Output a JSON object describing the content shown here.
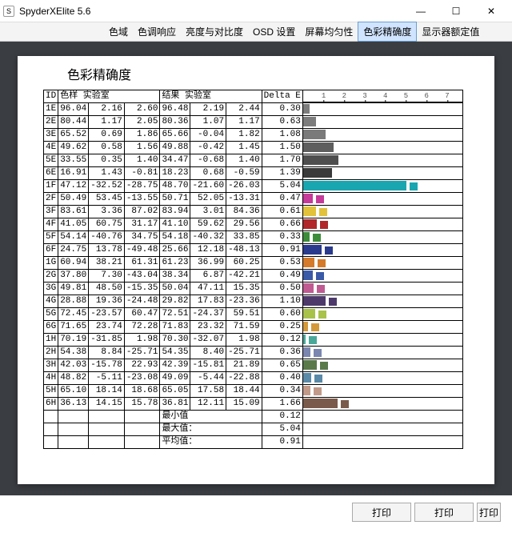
{
  "window": {
    "title": "SpyderXElite 5.6",
    "app_icon_letter": "S"
  },
  "tabs": {
    "items": [
      "色域",
      "色调响应",
      "亮度与对比度",
      "OSD 设置",
      "屏幕均匀性",
      "色彩精确度",
      "显示器额定值"
    ],
    "active_index": 5
  },
  "page_title": "色彩精确度",
  "headers": {
    "id": "ID",
    "sample_lab": "色样 实验室",
    "result_lab": "结果 实验室",
    "delta_e": "Delta E"
  },
  "axis": {
    "ticks": [
      1,
      2,
      3,
      4,
      5,
      6,
      7
    ],
    "max": 7
  },
  "rows": [
    {
      "id": "1E",
      "s": [
        96.04,
        2.16,
        2.6
      ],
      "r": [
        96.48,
        2.19,
        2.44
      ],
      "de": 0.3,
      "bar": "#7d7d7d",
      "sw": null
    },
    {
      "id": "2E",
      "s": [
        80.44,
        1.17,
        2.05
      ],
      "r": [
        80.36,
        1.07,
        1.17
      ],
      "de": 0.63,
      "bar": "#7c7c7c",
      "sw": null
    },
    {
      "id": "3E",
      "s": [
        65.52,
        0.69,
        1.86
      ],
      "r": [
        65.66,
        -0.04,
        1.82
      ],
      "de": 1.08,
      "bar": "#7a7a7a",
      "sw": null
    },
    {
      "id": "4E",
      "s": [
        49.62,
        0.58,
        1.56
      ],
      "r": [
        49.88,
        -0.42,
        1.45
      ],
      "de": 1.5,
      "bar": "#5e5e5e",
      "sw": null
    },
    {
      "id": "5E",
      "s": [
        33.55,
        0.35,
        1.4
      ],
      "r": [
        34.47,
        -0.68,
        1.4
      ],
      "de": 1.7,
      "bar": "#4e4e4e",
      "sw": null
    },
    {
      "id": "6E",
      "s": [
        16.91,
        1.43,
        -0.81
      ],
      "r": [
        18.23,
        0.68,
        -0.59
      ],
      "de": 1.39,
      "bar": "#3a3a3a",
      "sw": null
    },
    {
      "id": "1F",
      "s": [
        47.12,
        -32.52,
        -28.75
      ],
      "r": [
        48.7,
        -21.6,
        -26.03
      ],
      "de": 5.04,
      "bar": "#1aa6b0",
      "sw": "#1aa6b0"
    },
    {
      "id": "2F",
      "s": [
        50.49,
        53.45,
        -13.55
      ],
      "r": [
        50.71,
        52.05,
        -13.31
      ],
      "de": 0.47,
      "bar": "#c63a9a",
      "sw": "#c63a9a"
    },
    {
      "id": "3F",
      "s": [
        83.61,
        3.36,
        87.02
      ],
      "r": [
        83.94,
        3.01,
        84.36
      ],
      "de": 0.61,
      "bar": "#e2c23a",
      "sw": "#e2c23a"
    },
    {
      "id": "4F",
      "s": [
        41.05,
        60.75,
        31.17
      ],
      "r": [
        41.1,
        59.62,
        29.56
      ],
      "de": 0.66,
      "bar": "#b0262a",
      "sw": "#b0262a"
    },
    {
      "id": "5F",
      "s": [
        54.14,
        -40.76,
        34.75
      ],
      "r": [
        54.18,
        -40.32,
        33.85
      ],
      "de": 0.33,
      "bar": "#3d8c3a",
      "sw": "#3d8c3a"
    },
    {
      "id": "6F",
      "s": [
        24.75,
        13.78,
        -49.48
      ],
      "r": [
        25.66,
        12.18,
        -48.13
      ],
      "de": 0.91,
      "bar": "#2a3a8c",
      "sw": "#2a3a8c"
    },
    {
      "id": "1G",
      "s": [
        60.94,
        38.21,
        61.31
      ],
      "r": [
        61.23,
        36.99,
        60.25
      ],
      "de": 0.53,
      "bar": "#d47a2a",
      "sw": "#d47a2a"
    },
    {
      "id": "2G",
      "s": [
        37.8,
        7.3,
        -43.04
      ],
      "r": [
        38.34,
        6.87,
        -42.21
      ],
      "de": 0.49,
      "bar": "#3a5aa8",
      "sw": "#3a5aa8"
    },
    {
      "id": "3G",
      "s": [
        49.81,
        48.5,
        -15.35
      ],
      "r": [
        50.04,
        47.11,
        15.35
      ],
      "de": 0.5,
      "bar": "#c05a92",
      "sw": "#c05a92"
    },
    {
      "id": "4G",
      "s": [
        28.88,
        19.36,
        -24.48
      ],
      "r": [
        29.82,
        17.83,
        -23.36
      ],
      "de": 1.1,
      "bar": "#4e3a6a",
      "sw": "#4e3a6a"
    },
    {
      "id": "5G",
      "s": [
        72.45,
        -23.57,
        60.47
      ],
      "r": [
        72.51,
        -24.37,
        59.51
      ],
      "de": 0.6,
      "bar": "#a8c24a",
      "sw": "#a8c24a"
    },
    {
      "id": "6G",
      "s": [
        71.65,
        23.74,
        72.28
      ],
      "r": [
        71.83,
        23.32,
        71.59
      ],
      "de": 0.25,
      "bar": "#d49a3a",
      "sw": "#d49a3a"
    },
    {
      "id": "1H",
      "s": [
        70.19,
        -31.85,
        1.98
      ],
      "r": [
        70.3,
        -32.07,
        1.98
      ],
      "de": 0.12,
      "bar": "#4aa89a",
      "sw": "#4aa89a"
    },
    {
      "id": "2H",
      "s": [
        54.38,
        8.84,
        -25.71
      ],
      "r": [
        54.35,
        8.4,
        -25.71
      ],
      "de": 0.36,
      "bar": "#7a86b0",
      "sw": "#7a86b0"
    },
    {
      "id": "3H",
      "s": [
        42.03,
        -15.78,
        22.93
      ],
      "r": [
        42.39,
        -15.81,
        21.89
      ],
      "de": 0.65,
      "bar": "#5a7a4a",
      "sw": "#5a7a4a"
    },
    {
      "id": "4H",
      "s": [
        48.82,
        -5.11,
        -23.08
      ],
      "r": [
        49.09,
        -5.44,
        -22.88
      ],
      "de": 0.4,
      "bar": "#5a8aa8",
      "sw": "#5a8aa8"
    },
    {
      "id": "5H",
      "s": [
        65.1,
        18.14,
        18.68
      ],
      "r": [
        65.05,
        17.58,
        18.44
      ],
      "de": 0.34,
      "bar": "#c29a8a",
      "sw": "#c29a8a"
    },
    {
      "id": "6H",
      "s": [
        36.13,
        14.15,
        15.78
      ],
      "r": [
        36.81,
        12.11,
        15.09
      ],
      "de": 1.66,
      "bar": "#7a5a4a",
      "sw": "#7a5a4a"
    }
  ],
  "summary": {
    "min_label": "最小值",
    "min_value": 0.12,
    "max_label": "最大值：",
    "max_value": 5.04,
    "avg_label": "平均值：",
    "avg_value": 0.91
  },
  "footer": {
    "print": "打印"
  },
  "chart_data": {
    "type": "bar",
    "title": "色彩精确度 Delta E",
    "xlabel": "Delta E",
    "ylabel": "ID",
    "xlim": [
      0,
      7
    ],
    "categories": [
      "1E",
      "2E",
      "3E",
      "4E",
      "5E",
      "6E",
      "1F",
      "2F",
      "3F",
      "4F",
      "5F",
      "6F",
      "1G",
      "2G",
      "3G",
      "4G",
      "5G",
      "6G",
      "1H",
      "2H",
      "3H",
      "4H",
      "5H",
      "6H"
    ],
    "series": [
      {
        "name": "Delta E",
        "values": [
          0.3,
          0.63,
          1.08,
          1.5,
          1.7,
          1.39,
          5.04,
          0.47,
          0.61,
          0.66,
          0.33,
          0.91,
          0.53,
          0.49,
          0.5,
          1.1,
          0.6,
          0.25,
          0.12,
          0.36,
          0.65,
          0.4,
          0.34,
          1.66
        ]
      }
    ]
  }
}
